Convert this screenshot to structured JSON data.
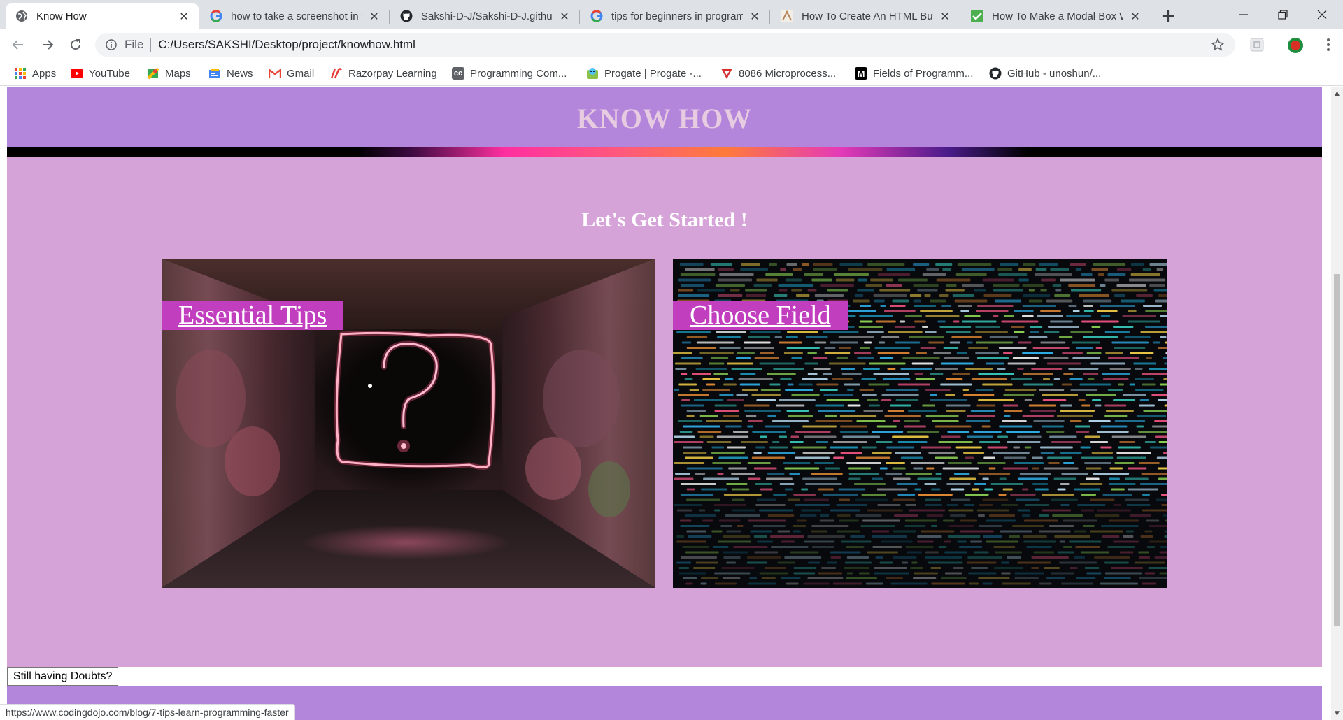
{
  "browser": {
    "tabs": [
      {
        "title": "Know How",
        "icon": "globe-icon",
        "active": true
      },
      {
        "title": "how to take a screenshot in w",
        "icon": "google-icon"
      },
      {
        "title": "Sakshi-D-J/Sakshi-D-J.githuk",
        "icon": "github-icon"
      },
      {
        "title": "tips for beginners in program",
        "icon": "google-icon"
      },
      {
        "title": "How To Create An HTML Butt",
        "icon": "w3-icon"
      },
      {
        "title": "How To Make a Modal Box W",
        "icon": "w3schools-icon"
      }
    ],
    "new_tab": "+",
    "url_scheme": "File",
    "url": "C:/Users/SAKSHI/Desktop/project/knowhow.html",
    "bookmarks": [
      {
        "label": "Apps",
        "icon": "apps-grid-icon",
        "color": "#e8453c"
      },
      {
        "label": "YouTube",
        "icon": "youtube-icon",
        "color": "#ff0000"
      },
      {
        "label": "Maps",
        "icon": "maps-icon",
        "color": "#34a853"
      },
      {
        "label": "News",
        "icon": "news-icon",
        "color": "#4285f4"
      },
      {
        "label": "Gmail",
        "icon": "gmail-icon",
        "color": "#ea4335"
      },
      {
        "label": "Razorpay Learning",
        "icon": "razorpay-icon",
        "color": "#e53935"
      },
      {
        "label": "Programming Com...",
        "icon": "cc-icon",
        "color": "#5f6368"
      },
      {
        "label": "Progate | Progate -...",
        "icon": "progate-icon",
        "color": "#43a047"
      },
      {
        "label": "8086 Microprocess...",
        "icon": "v-icon",
        "color": "#d32f2f"
      },
      {
        "label": "Fields of Programm...",
        "icon": "medium-icon",
        "color": "#000000"
      },
      {
        "label": "GitHub - unoshun/...",
        "icon": "github-icon",
        "color": "#24292e"
      }
    ],
    "status_url": "https://www.codingdojo.com/blog/7-tips-learn-programming-faster"
  },
  "page": {
    "heading": "KNOW HOW",
    "subtitle": "Let's Get Started !",
    "cards": [
      {
        "label": "Essential Tips",
        "image": "neon-question-mark-tunnel"
      },
      {
        "label": "Choose Field",
        "image": "code-on-dark-screen"
      }
    ],
    "doubt_button": "Still having Doubts?"
  },
  "colors": {
    "header_bg": "#b386dc",
    "content_bg": "#d6a3d8",
    "heading_text": "#e7cbe0",
    "card_label_bg": "#c13fbf"
  }
}
